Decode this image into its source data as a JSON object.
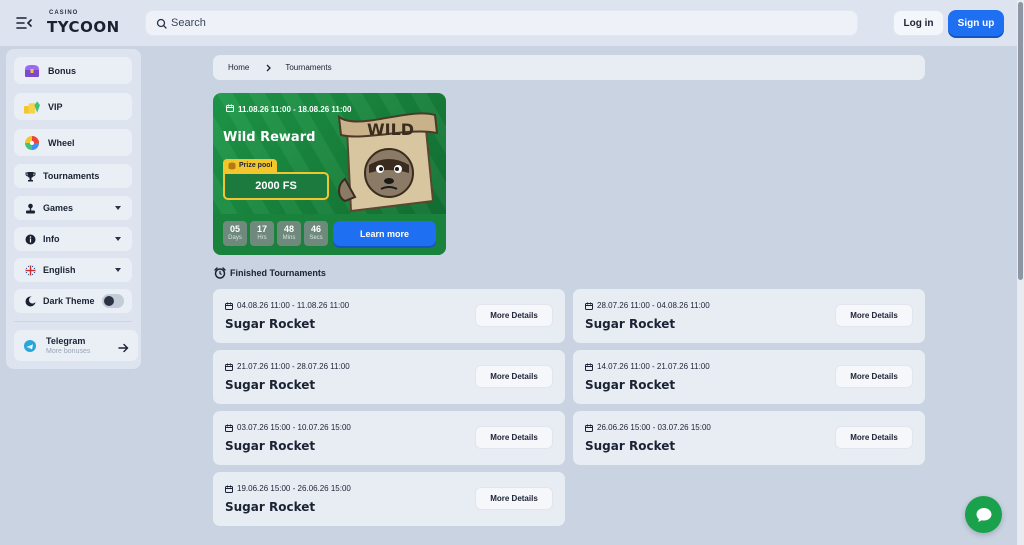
{
  "header": {
    "logo_small": "CASINO",
    "logo_big": "TYCOON",
    "search_placeholder": "Search",
    "login_label": "Log in",
    "signup_label": "Sign up"
  },
  "sidebar": {
    "items": [
      {
        "label": "Bonus",
        "icon": "treasure-chest-icon"
      },
      {
        "label": "VIP",
        "icon": "vip-icon"
      },
      {
        "label": "Wheel",
        "icon": "wheel-icon"
      },
      {
        "label": "Tournaments",
        "icon": "trophy-icon"
      },
      {
        "label": "Games",
        "icon": "joystick-icon"
      },
      {
        "label": "Info",
        "icon": "info-icon"
      },
      {
        "label": "English",
        "icon": "uk-flag-icon"
      },
      {
        "label": "Dark Theme",
        "icon": "moon-icon"
      }
    ],
    "telegram": {
      "title": "Telegram",
      "subtitle": "More bonuses"
    }
  },
  "breadcrumb": {
    "home": "Home",
    "current": "Tournaments"
  },
  "active_tournament": {
    "dates": "11.08.26 11:00 - 18.08.26 11:00",
    "title": "Wild Reward",
    "prize_label": "Prize pool",
    "prize_value": "2000 FS",
    "art_text": "WILD",
    "countdown": [
      {
        "value": "05",
        "unit": "Days"
      },
      {
        "value": "17",
        "unit": "Hrs"
      },
      {
        "value": "48",
        "unit": "Mins"
      },
      {
        "value": "46",
        "unit": "Secs"
      }
    ],
    "cta": "Learn more",
    "colors": {
      "background": "#1e9a4a",
      "prize": "#f3c62e",
      "cta": "#1f6ff2"
    }
  },
  "finished": {
    "title": "Finished Tournaments",
    "more_label": "More Details",
    "items": [
      {
        "dates": "04.08.26 11:00 - 11.08.26 11:00",
        "name": "Sugar Rocket"
      },
      {
        "dates": "28.07.26 11:00 - 04.08.26 11:00",
        "name": "Sugar Rocket"
      },
      {
        "dates": "21.07.26 11:00 - 28.07.26 11:00",
        "name": "Sugar Rocket"
      },
      {
        "dates": "14.07.26 11:00 - 21.07.26 11:00",
        "name": "Sugar Rocket"
      },
      {
        "dates": "03.07.26 15:00 - 10.07.26 15:00",
        "name": "Sugar Rocket"
      },
      {
        "dates": "26.06.26 15:00 - 03.07.26 15:00",
        "name": "Sugar Rocket"
      },
      {
        "dates": "19.06.26 15:00 - 26.06.26 15:00",
        "name": "Sugar Rocket"
      }
    ]
  },
  "colors": {
    "accent": "#1f6ff2",
    "page_bg": "#c9d3e2",
    "chat": "#1aa14c"
  }
}
